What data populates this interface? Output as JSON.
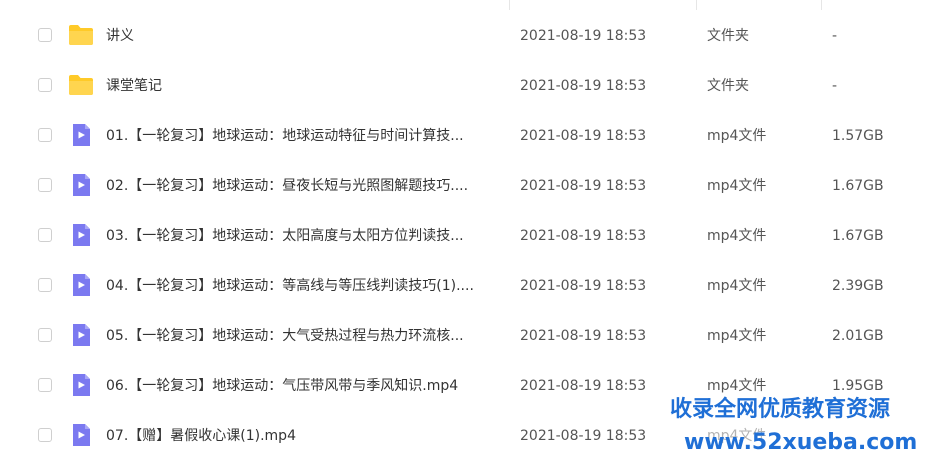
{
  "files": [
    {
      "name": "讲义",
      "date": "2021-08-19 18:53",
      "type": "文件夹",
      "size": "-",
      "icon": "folder-icon"
    },
    {
      "name": "课堂笔记",
      "date": "2021-08-19 18:53",
      "type": "文件夹",
      "size": "-",
      "icon": "folder-icon"
    },
    {
      "name": "01.【一轮复习】地球运动：地球运动特征与时间计算技...",
      "date": "2021-08-19 18:53",
      "type": "mp4文件",
      "size": "1.57GB",
      "icon": "video-file-icon"
    },
    {
      "name": "02.【一轮复习】地球运动：昼夜长短与光照图解题技巧....",
      "date": "2021-08-19 18:53",
      "type": "mp4文件",
      "size": "1.67GB",
      "icon": "video-file-icon"
    },
    {
      "name": "03.【一轮复习】地球运动：太阳高度与太阳方位判读技...",
      "date": "2021-08-19 18:53",
      "type": "mp4文件",
      "size": "1.67GB",
      "icon": "video-file-icon"
    },
    {
      "name": "04.【一轮复习】地球运动：等高线与等压线判读技巧(1)....",
      "date": "2021-08-19 18:53",
      "type": "mp4文件",
      "size": "2.39GB",
      "icon": "video-file-icon"
    },
    {
      "name": "05.【一轮复习】地球运动：大气受热过程与热力环流核...",
      "date": "2021-08-19 18:53",
      "type": "mp4文件",
      "size": "2.01GB",
      "icon": "video-file-icon"
    },
    {
      "name": "06.【一轮复习】地球运动：气压带风带与季风知识.mp4",
      "date": "2021-08-19 18:53",
      "type": "mp4文件",
      "size": "1.95GB",
      "icon": "video-file-icon"
    },
    {
      "name": "07.【赠】暑假收心课(1).mp4",
      "date": "2021-08-19 18:53",
      "type": "mp4文件",
      "size": "",
      "icon": "video-file-icon"
    }
  ],
  "watermark": {
    "line1": "收录全网优质教育资源",
    "line2": "www.52xueba.com"
  },
  "colors": {
    "folder": "#FFCA28",
    "video": "#7B79F0",
    "watermark": "#1F6FD6"
  }
}
